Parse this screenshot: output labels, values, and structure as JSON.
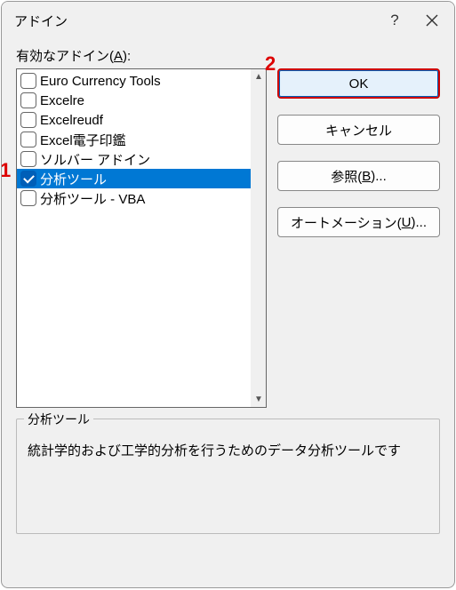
{
  "title": "アドイン",
  "label_prefix": "有効なアドイン(",
  "label_accel": "A",
  "label_suffix": "):",
  "items": [
    {
      "label": "Euro Currency Tools",
      "checked": false,
      "selected": false
    },
    {
      "label": "Excelre",
      "checked": false,
      "selected": false
    },
    {
      "label": "Excelreudf",
      "checked": false,
      "selected": false
    },
    {
      "label": "Excel電子印鑑",
      "checked": false,
      "selected": false
    },
    {
      "label": "ソルバー アドイン",
      "checked": false,
      "selected": false
    },
    {
      "label": "分析ツール",
      "checked": true,
      "selected": true
    },
    {
      "label": "分析ツール - VBA",
      "checked": false,
      "selected": false
    }
  ],
  "buttons": {
    "ok": "OK",
    "cancel": "キャンセル",
    "browse_pre": "参照(",
    "browse_accel": "B",
    "browse_post": ")...",
    "automation_pre": "オートメーション(",
    "automation_accel": "U",
    "automation_post": ")..."
  },
  "description": {
    "legend": "分析ツール",
    "text": "統計学的および工学的分析を行うためのデータ分析ツールです"
  },
  "annotations": {
    "a1": "1",
    "a2": "2"
  }
}
